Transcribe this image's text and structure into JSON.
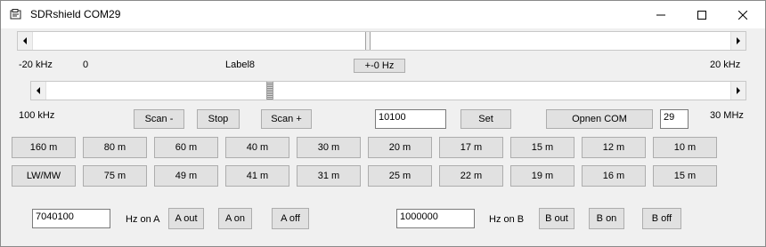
{
  "window": {
    "title": "SDRshield COM29",
    "icon": "app-icon",
    "controls": [
      "minimize-icon",
      "maximize-icon",
      "close-icon"
    ]
  },
  "scroll_top": {
    "thumb_level": 0.5
  },
  "freq_labels": {
    "minus": "-20 kHz",
    "zero": "0",
    "label8": "Label8",
    "offset_button": "+-0 Hz",
    "plus": "20 kHz"
  },
  "scroll_main": {
    "thumb_level": 0.33
  },
  "range": {
    "min": "100 kHz",
    "max": "30 MHz"
  },
  "controls": {
    "scan_minus": "Scan -",
    "stop": "Stop",
    "scan_plus": "Scan +",
    "freq_input": "10100",
    "set": "Set",
    "open_com": "Opnen COM",
    "com_port": "29"
  },
  "bands_row1": [
    "160 m",
    "80 m",
    "60 m",
    "40 m",
    "30 m",
    "20 m",
    "17 m",
    "15 m",
    "12 m",
    "10 m"
  ],
  "bands_row2": [
    "LW/MW",
    "75 m",
    "49 m",
    "41 m",
    "31 m",
    "25 m",
    "22 m",
    "19 m",
    "16 m",
    "15 m"
  ],
  "osc_a": {
    "value": "7040100",
    "unit": "Hz on A",
    "out": "A out",
    "on": "A on",
    "off": "A off"
  },
  "osc_b": {
    "value": "1000000",
    "unit": "Hz on B",
    "out": "B out",
    "on": "B on",
    "off": "B off"
  }
}
